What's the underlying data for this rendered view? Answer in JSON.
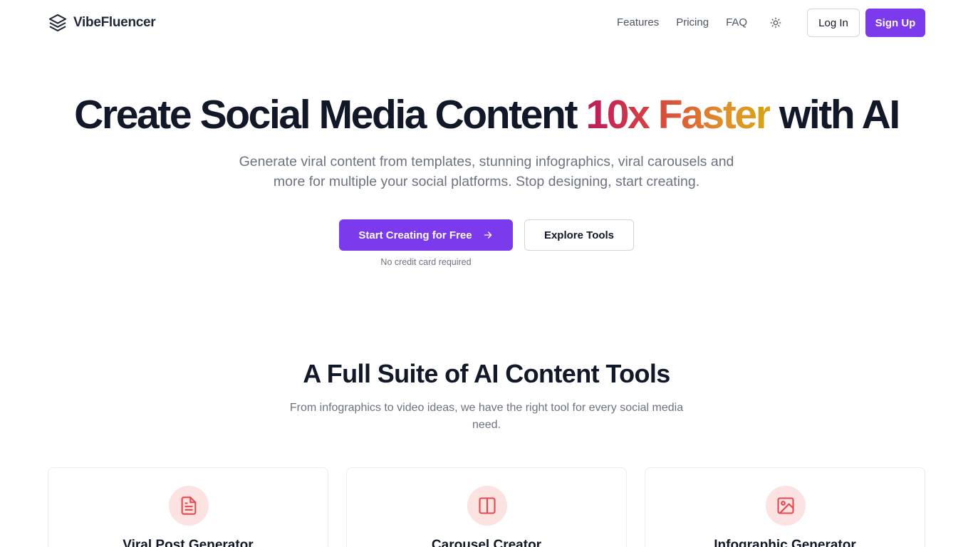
{
  "brand": {
    "name": "VibeFluencer"
  },
  "nav": {
    "items": [
      "Features",
      "Pricing",
      "FAQ"
    ]
  },
  "auth": {
    "login_label": "Log In",
    "signup_label": "Sign Up"
  },
  "hero": {
    "title_pre": "Create Social Media Content ",
    "title_highlight": "10x Faster",
    "title_post": " with AI",
    "subtitle": "Generate viral content from templates, stunning infographics, viral carousels and more for multiple your social platforms. Stop designing, start creating.",
    "primary_cta": "Start Creating for Free",
    "secondary_cta": "Explore Tools",
    "note": "No credit card required"
  },
  "tools": {
    "title": "A Full Suite of AI Content Tools",
    "subtitle": "From infographics to video ideas, we have the right tool for every social media need.",
    "cards": [
      {
        "title": "Viral Post Generator",
        "icon": "document-icon"
      },
      {
        "title": "Carousel Creator",
        "icon": "columns-icon"
      },
      {
        "title": "Infographic Generator",
        "icon": "image-icon"
      }
    ]
  },
  "colors": {
    "accent": "#7c3aed",
    "icon_bg": "#fde2e2",
    "icon_fg": "#e5484d"
  }
}
